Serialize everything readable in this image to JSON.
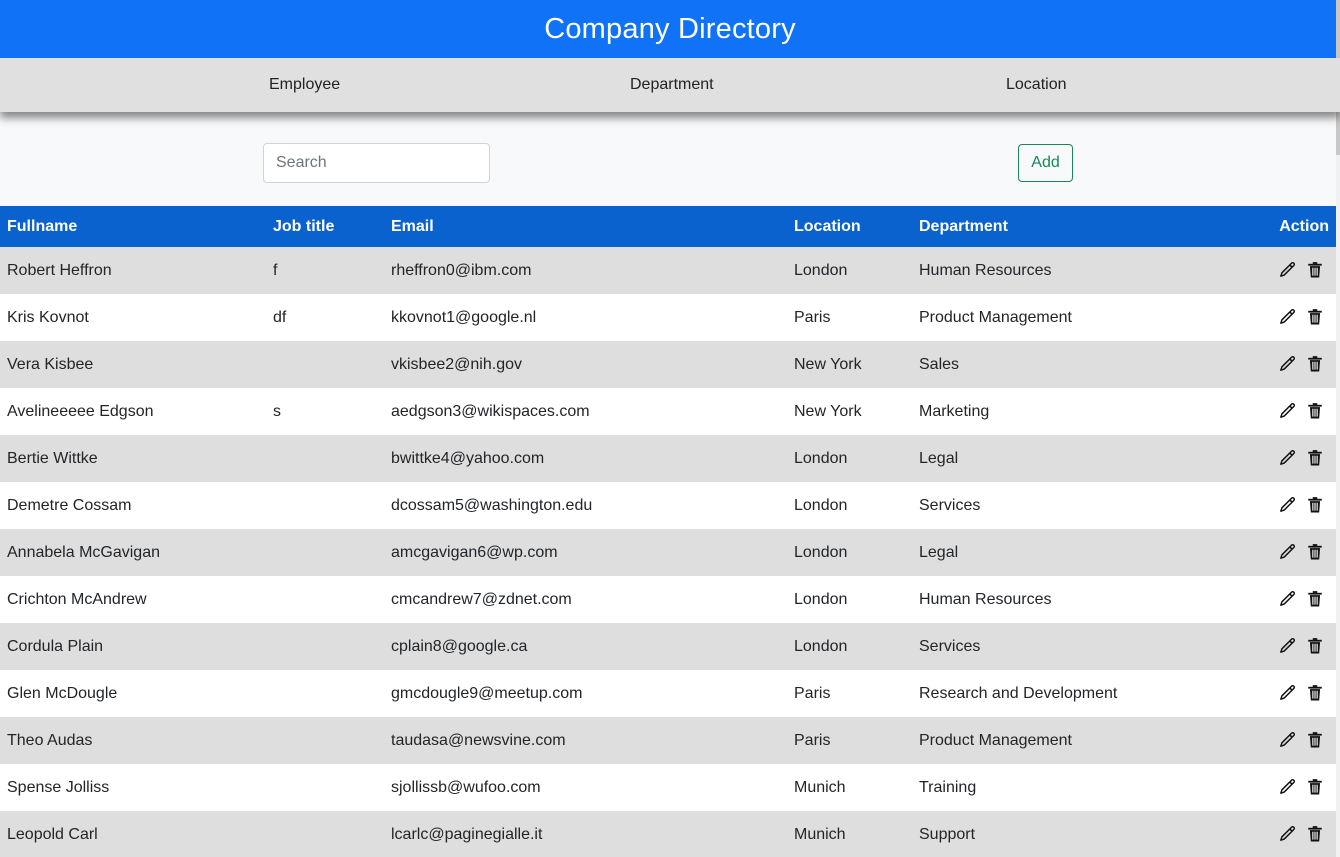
{
  "header": {
    "title": "Company Directory"
  },
  "nav": {
    "employee": "Employee",
    "department": "Department",
    "location": "Location"
  },
  "search": {
    "placeholder": "Search",
    "value": ""
  },
  "toolbar": {
    "add_label": "Add"
  },
  "table": {
    "columns": {
      "fullname": "Fullname",
      "job_title": "Job title",
      "email": "Email",
      "location": "Location",
      "department": "Department",
      "action": "Action"
    },
    "rows": [
      {
        "fullname": "Robert Heffron",
        "job_title": "f",
        "email": "rheffron0@ibm.com",
        "location": "London",
        "department": "Human Resources"
      },
      {
        "fullname": "Kris Kovnot",
        "job_title": "df",
        "email": "kkovnot1@google.nl",
        "location": "Paris",
        "department": "Product Management"
      },
      {
        "fullname": "Vera Kisbee",
        "job_title": "",
        "email": "vkisbee2@nih.gov",
        "location": "New York",
        "department": "Sales"
      },
      {
        "fullname": "Avelineeeee Edgson",
        "job_title": "s",
        "email": "aedgson3@wikispaces.com",
        "location": "New York",
        "department": "Marketing"
      },
      {
        "fullname": "Bertie Wittke",
        "job_title": "",
        "email": "bwittke4@yahoo.com",
        "location": "London",
        "department": "Legal"
      },
      {
        "fullname": "Demetre Cossam",
        "job_title": "",
        "email": "dcossam5@washington.edu",
        "location": "London",
        "department": "Services"
      },
      {
        "fullname": "Annabela McGavigan",
        "job_title": "",
        "email": "amcgavigan6@wp.com",
        "location": "London",
        "department": "Legal"
      },
      {
        "fullname": "Crichton McAndrew",
        "job_title": "",
        "email": "cmcandrew7@zdnet.com",
        "location": "London",
        "department": "Human Resources"
      },
      {
        "fullname": "Cordula Plain",
        "job_title": "",
        "email": "cplain8@google.ca",
        "location": "London",
        "department": "Services"
      },
      {
        "fullname": "Glen McDougle",
        "job_title": "",
        "email": "gmcdougle9@meetup.com",
        "location": "Paris",
        "department": "Research and Development"
      },
      {
        "fullname": "Theo Audas",
        "job_title": "",
        "email": "taudasa@newsvine.com",
        "location": "Paris",
        "department": "Product Management"
      },
      {
        "fullname": "Spense Jolliss",
        "job_title": "",
        "email": "sjollissb@wufoo.com",
        "location": "Munich",
        "department": "Training"
      },
      {
        "fullname": "Leopold Carl",
        "job_title": "",
        "email": "lcarlc@paginegialle.it",
        "location": "Munich",
        "department": "Support"
      }
    ],
    "row_actions": {
      "edit_icon": "pencil-icon",
      "delete_icon": "trash-icon"
    }
  },
  "colors": {
    "header_bg": "#1073f7",
    "navbar_bg": "#e0e0e0",
    "table_header_bg": "#0a62cf",
    "row_alt_bg": "#dedede",
    "add_button": "#198754"
  }
}
